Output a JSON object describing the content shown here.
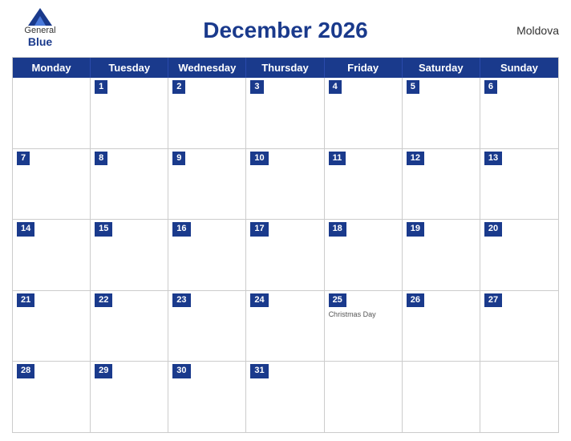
{
  "header": {
    "title": "December 2026",
    "country": "Moldova",
    "logo": {
      "general": "General",
      "blue": "Blue"
    }
  },
  "dayHeaders": [
    "Monday",
    "Tuesday",
    "Wednesday",
    "Thursday",
    "Friday",
    "Saturday",
    "Sunday"
  ],
  "weeks": [
    [
      {
        "day": "",
        "holiday": ""
      },
      {
        "day": "1",
        "holiday": ""
      },
      {
        "day": "2",
        "holiday": ""
      },
      {
        "day": "3",
        "holiday": ""
      },
      {
        "day": "4",
        "holiday": ""
      },
      {
        "day": "5",
        "holiday": ""
      },
      {
        "day": "6",
        "holiday": ""
      }
    ],
    [
      {
        "day": "7",
        "holiday": ""
      },
      {
        "day": "8",
        "holiday": ""
      },
      {
        "day": "9",
        "holiday": ""
      },
      {
        "day": "10",
        "holiday": ""
      },
      {
        "day": "11",
        "holiday": ""
      },
      {
        "day": "12",
        "holiday": ""
      },
      {
        "day": "13",
        "holiday": ""
      }
    ],
    [
      {
        "day": "14",
        "holiday": ""
      },
      {
        "day": "15",
        "holiday": ""
      },
      {
        "day": "16",
        "holiday": ""
      },
      {
        "day": "17",
        "holiday": ""
      },
      {
        "day": "18",
        "holiday": ""
      },
      {
        "day": "19",
        "holiday": ""
      },
      {
        "day": "20",
        "holiday": ""
      }
    ],
    [
      {
        "day": "21",
        "holiday": ""
      },
      {
        "day": "22",
        "holiday": ""
      },
      {
        "day": "23",
        "holiday": ""
      },
      {
        "day": "24",
        "holiday": ""
      },
      {
        "day": "25",
        "holiday": "Christmas Day"
      },
      {
        "day": "26",
        "holiday": ""
      },
      {
        "day": "27",
        "holiday": ""
      }
    ],
    [
      {
        "day": "28",
        "holiday": ""
      },
      {
        "day": "29",
        "holiday": ""
      },
      {
        "day": "30",
        "holiday": ""
      },
      {
        "day": "31",
        "holiday": ""
      },
      {
        "day": "",
        "holiday": ""
      },
      {
        "day": "",
        "holiday": ""
      },
      {
        "day": "",
        "holiday": ""
      }
    ]
  ]
}
